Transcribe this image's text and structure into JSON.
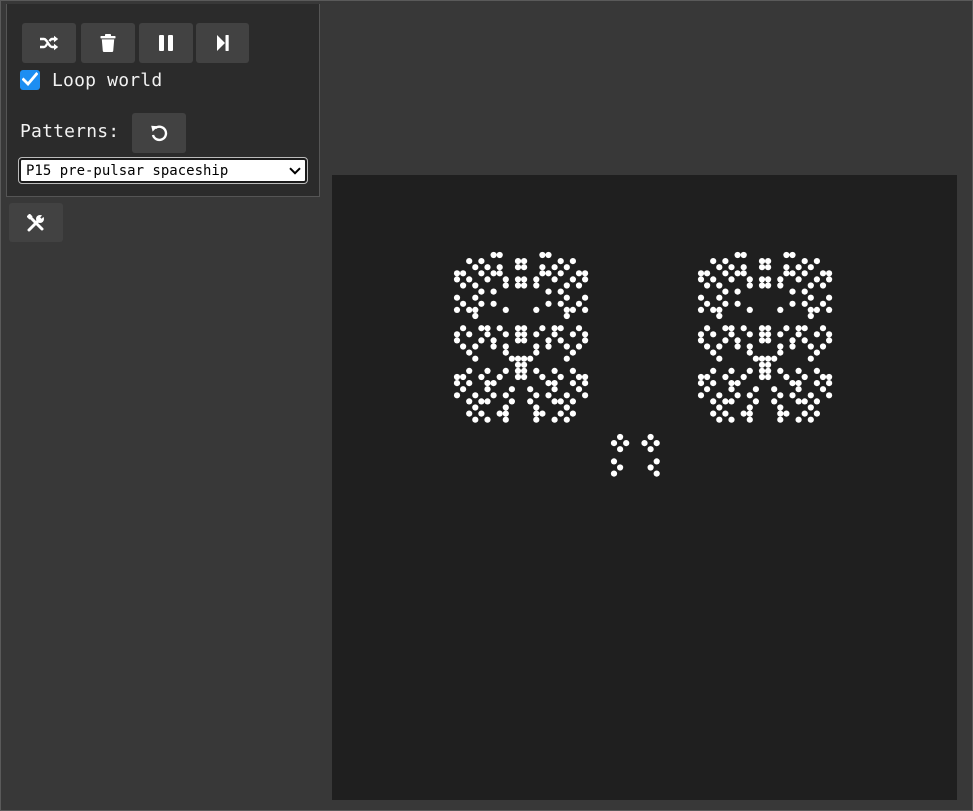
{
  "toolbar": {
    "buttons": [
      {
        "name": "randomize",
        "icon": "shuffle-icon"
      },
      {
        "name": "clear",
        "icon": "trash-icon"
      },
      {
        "name": "pause",
        "icon": "pause-icon"
      },
      {
        "name": "step",
        "icon": "step-forward-icon"
      }
    ]
  },
  "loop_world": {
    "label": "Loop world",
    "checked": true,
    "color": "#1d8ef2"
  },
  "patterns": {
    "label": "Patterns:",
    "reset_icon": "rotate-left-icon",
    "selected": "P15 pre-pulsar spaceship"
  },
  "tools": {
    "icon": "wrench-screwdriver-icon"
  },
  "world": {
    "background": "#1f1f1f",
    "cell_color": "#ffffff"
  }
}
